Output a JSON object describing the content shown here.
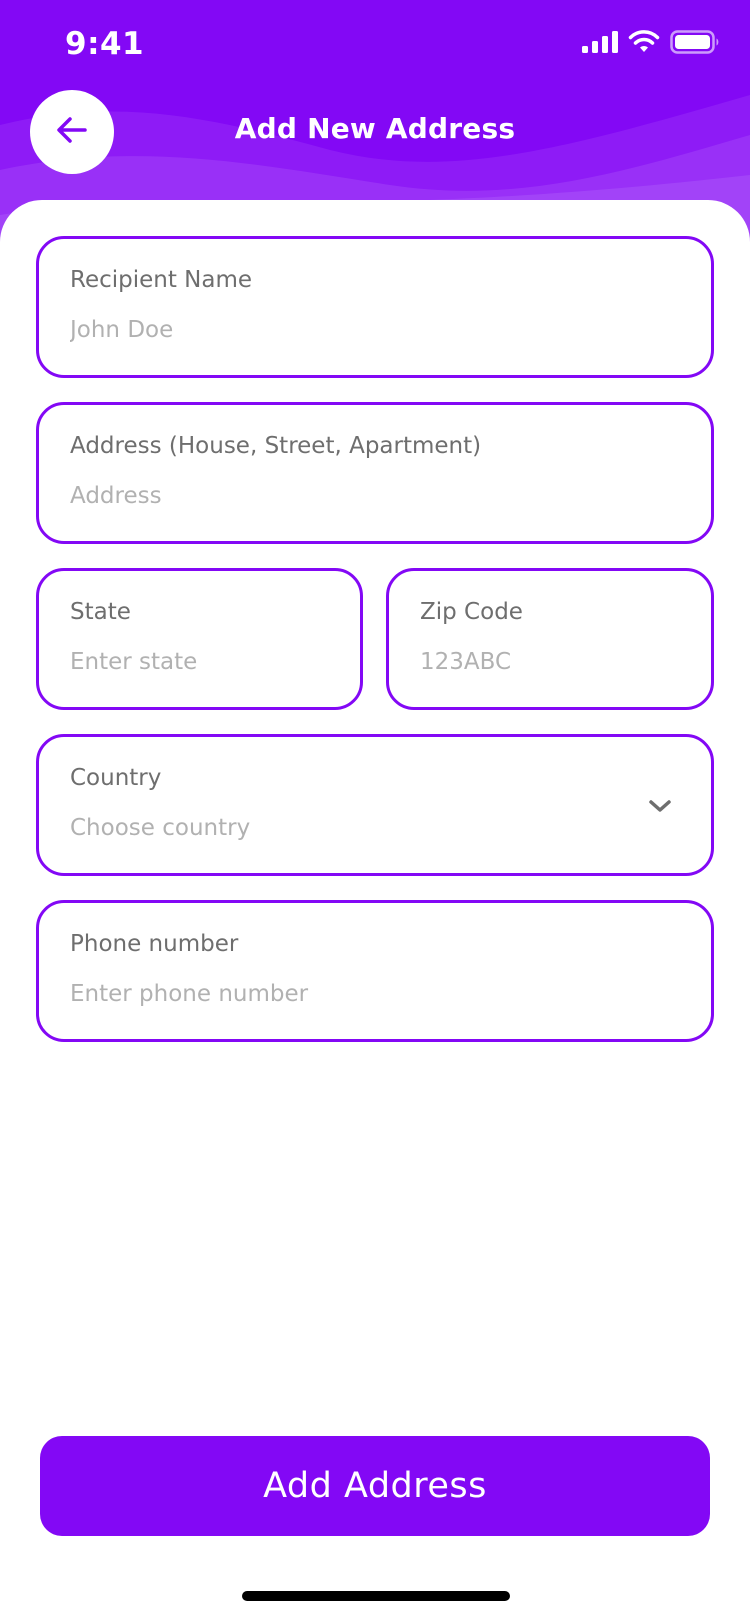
{
  "status_bar": {
    "time": "9:41"
  },
  "header": {
    "title": "Add New Address",
    "back_icon": "arrow-left-icon"
  },
  "form": {
    "recipient_name": {
      "label": "Recipient Name",
      "placeholder": "John Doe"
    },
    "address": {
      "label": "Address (House, Street, Apartment)",
      "placeholder": "Address"
    },
    "state": {
      "label": "State",
      "placeholder": "Enter state"
    },
    "zip_code": {
      "label": "Zip Code",
      "placeholder": "123ABC"
    },
    "country": {
      "label": "Country",
      "placeholder": "Choose country",
      "icon": "chevron-down-icon"
    },
    "phone": {
      "label": "Phone number",
      "placeholder": "Enter phone number"
    }
  },
  "actions": {
    "submit_label": "Add Address"
  },
  "colors": {
    "accent": "#8308f5",
    "label": "#6e6e6e",
    "placeholder": "#b1b1b1",
    "background": "#ffffff"
  }
}
